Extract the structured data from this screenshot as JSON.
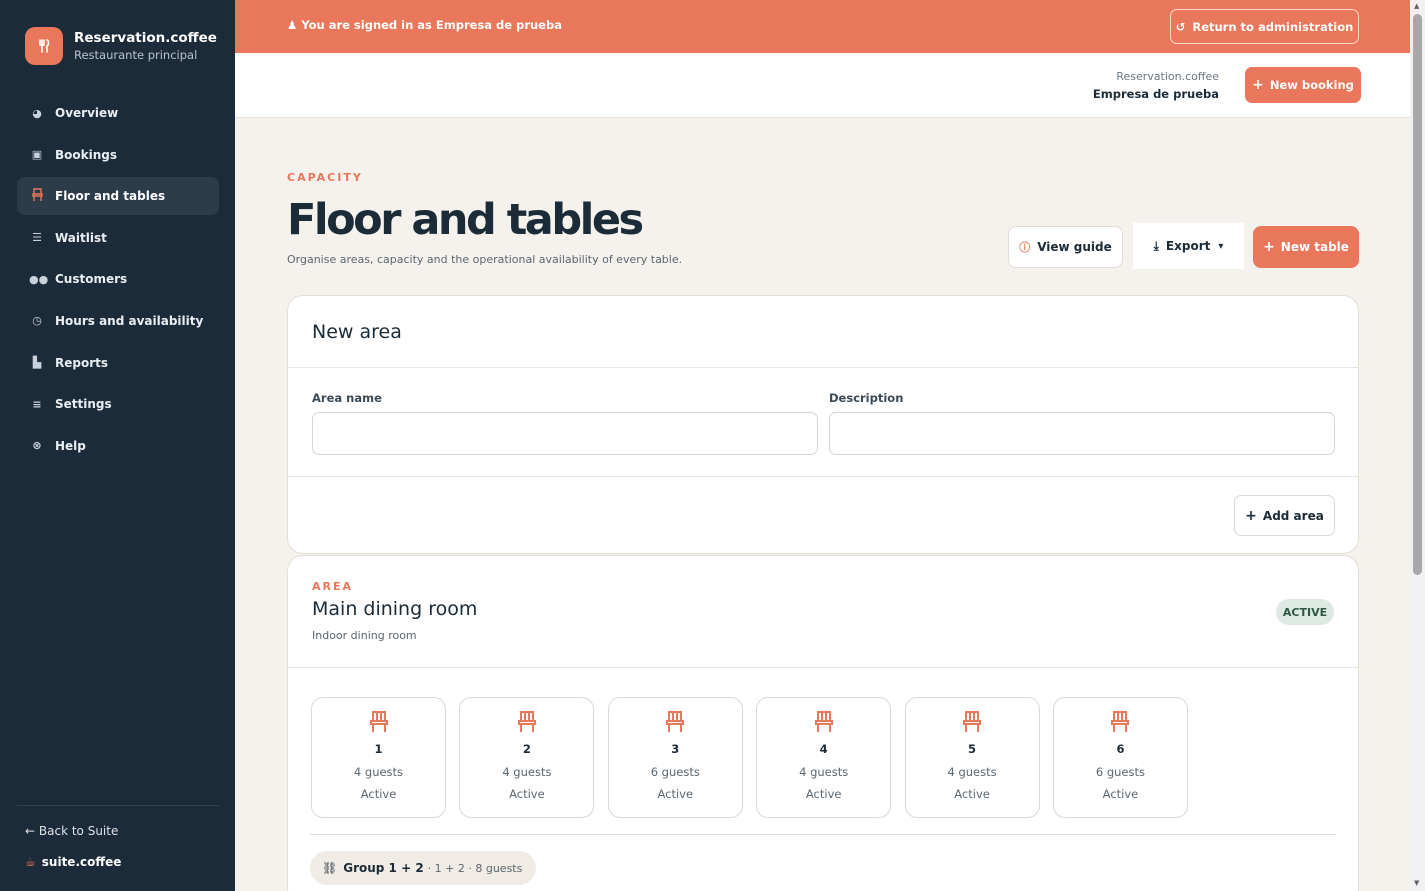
{
  "brand": {
    "name": "Reservation.coffee",
    "subtitle": "Restaurante principal",
    "logo_glyph": "⑂"
  },
  "sidebar": {
    "items": [
      {
        "label": "Overview",
        "icon": "pie-chart-icon"
      },
      {
        "label": "Bookings",
        "icon": "calendar-icon"
      },
      {
        "label": "Floor and tables",
        "icon": "chair-icon",
        "active": true
      },
      {
        "label": "Waitlist",
        "icon": "list-icon"
      },
      {
        "label": "Customers",
        "icon": "users-icon"
      },
      {
        "label": "Hours and availability",
        "icon": "clock-icon"
      },
      {
        "label": "Reports",
        "icon": "bar-chart-icon"
      },
      {
        "label": "Settings",
        "icon": "sliders-icon"
      },
      {
        "label": "Help",
        "icon": "help-buoy-icon"
      }
    ],
    "back_label": "Back to Suite",
    "suite_label": "suite.coffee"
  },
  "banner": {
    "message": "You are signed in as Empresa de prueba",
    "return_label": "Return to administration"
  },
  "header": {
    "app_name": "Reservation.coffee",
    "company": "Empresa de prueba",
    "new_booking_label": "New booking"
  },
  "page": {
    "eyebrow": "CAPACITY",
    "title": "Floor and tables",
    "description": "Organise areas, capacity and the operational availability of every table.",
    "view_guide_label": "View guide",
    "export_label": "Export",
    "new_table_label": "New table"
  },
  "new_area": {
    "title": "New area",
    "name_label": "Area name",
    "name_value": "",
    "description_label": "Description",
    "description_value": "",
    "add_label": "Add area"
  },
  "area": {
    "eyebrow": "AREA",
    "name": "Main dining room",
    "description": "Indoor dining room",
    "status": "ACTIVE",
    "tables": [
      {
        "number": "1",
        "guests": "4 guests",
        "status": "Active"
      },
      {
        "number": "2",
        "guests": "4 guests",
        "status": "Active"
      },
      {
        "number": "3",
        "guests": "6 guests",
        "status": "Active"
      },
      {
        "number": "4",
        "guests": "4 guests",
        "status": "Active"
      },
      {
        "number": "5",
        "guests": "4 guests",
        "status": "Active"
      },
      {
        "number": "6",
        "guests": "6 guests",
        "status": "Active"
      }
    ],
    "group": {
      "name": "Group 1 + 2",
      "meta": "· 1 + 2 · 8 guests"
    }
  },
  "colors": {
    "accent": "#e8775b",
    "sidebar_bg": "#1c2b39",
    "page_bg": "#f5f2ed",
    "active_badge_bg": "#dfe9e4"
  }
}
